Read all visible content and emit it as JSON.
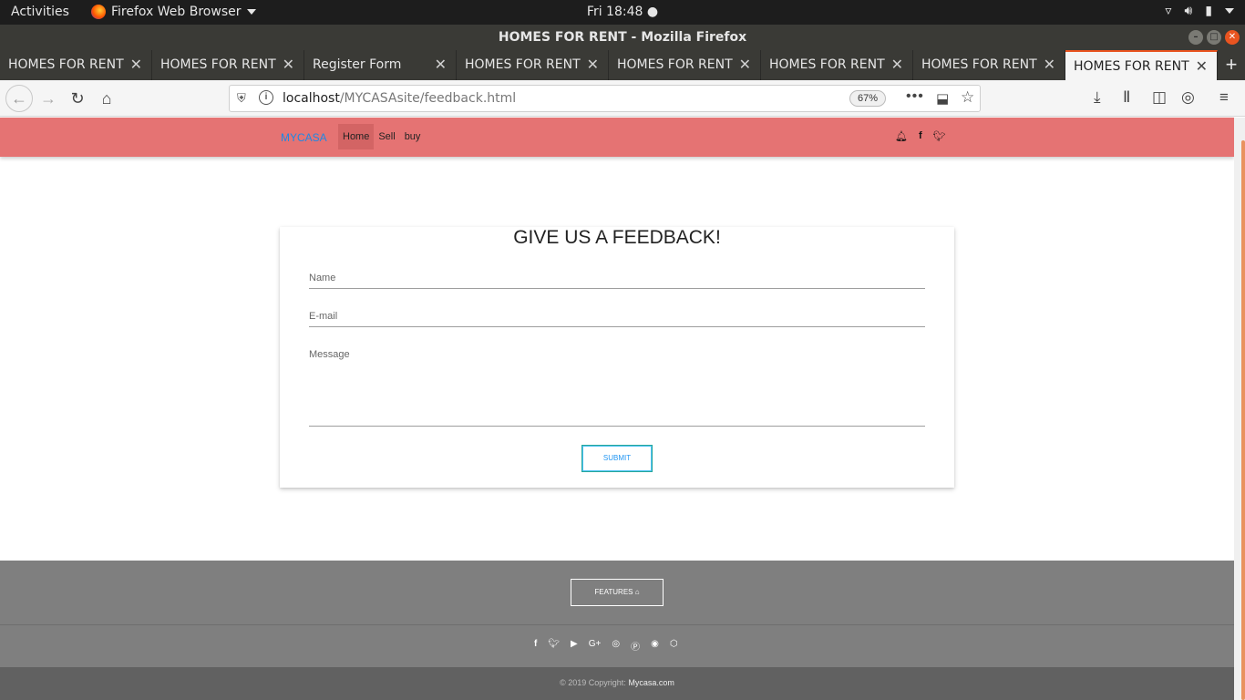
{
  "system": {
    "activities": "Activities",
    "app_menu": "Firefox Web Browser",
    "clock": "Fri 18:48 ●"
  },
  "window": {
    "title": "HOMES FOR RENT - Mozilla Firefox"
  },
  "tabs": [
    {
      "label": "HOMES FOR RENT"
    },
    {
      "label": "HOMES FOR RENT"
    },
    {
      "label": "Register Form"
    },
    {
      "label": "HOMES FOR RENT"
    },
    {
      "label": "HOMES FOR RENT"
    },
    {
      "label": "HOMES FOR RENT"
    },
    {
      "label": "HOMES FOR RENT"
    },
    {
      "label": "HOMES FOR RENT"
    }
  ],
  "browser": {
    "url_host": "localhost",
    "url_path": "/MYCASAsite/feedback.html",
    "zoom": "67%"
  },
  "site_nav": {
    "brand": "MYCASA",
    "links": [
      "Home",
      "Sell",
      "buy"
    ],
    "active_link": "Home",
    "icons": [
      "bell-icon",
      "facebook-icon",
      "twitter-icon"
    ]
  },
  "form": {
    "heading": "GIVE US A FEEDBACK!",
    "name_label": "Name",
    "email_label": "E-mail",
    "message_label": "Message",
    "submit": "SUBMIT"
  },
  "footer": {
    "features_button": "FEATURES",
    "social_icons": [
      "facebook-icon",
      "twitter-icon",
      "youtube-icon",
      "google-plus-icon",
      "dribbble-icon",
      "pinterest-icon",
      "github-icon",
      "codepen-icon"
    ],
    "copyright": "© 2019 Copyright:",
    "site": "Mycasa.com"
  },
  "colors": {
    "nav_background": "#e57373",
    "brand": "#1e88e5",
    "footer": "#7f7f7f",
    "footer_bottom": "#616161",
    "accent_tab": "#e95420"
  }
}
